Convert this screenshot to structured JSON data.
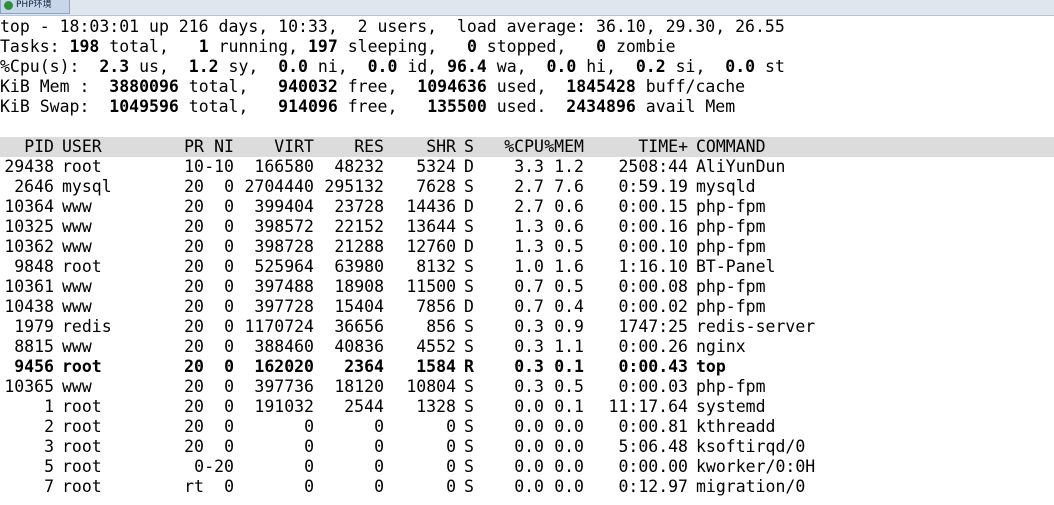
{
  "window": {
    "tab_title": "PHP环境"
  },
  "summary": {
    "line1": "top - 18:03:01 up 216 days, 10:33,  2 users,  load average: 36.10, 29.30, 26.55",
    "tasks": [
      {
        "t": "Tasks: ",
        "b": false
      },
      {
        "t": "198",
        "b": true
      },
      {
        "t": " total,   ",
        "b": false
      },
      {
        "t": "1",
        "b": true
      },
      {
        "t": " running, ",
        "b": false
      },
      {
        "t": "197",
        "b": true
      },
      {
        "t": " sleeping,   ",
        "b": false
      },
      {
        "t": "0",
        "b": true
      },
      {
        "t": " stopped,   ",
        "b": false
      },
      {
        "t": "0",
        "b": true
      },
      {
        "t": " zombie",
        "b": false
      }
    ],
    "cpu": [
      {
        "t": "%Cpu(s):  ",
        "b": false
      },
      {
        "t": "2.3",
        "b": true
      },
      {
        "t": " us,  ",
        "b": false
      },
      {
        "t": "1.2",
        "b": true
      },
      {
        "t": " sy,  ",
        "b": false
      },
      {
        "t": "0.0",
        "b": true
      },
      {
        "t": " ni,  ",
        "b": false
      },
      {
        "t": "0.0",
        "b": true
      },
      {
        "t": " id, ",
        "b": false
      },
      {
        "t": "96.4",
        "b": true
      },
      {
        "t": " wa,  ",
        "b": false
      },
      {
        "t": "0.0",
        "b": true
      },
      {
        "t": " hi,  ",
        "b": false
      },
      {
        "t": "0.2",
        "b": true
      },
      {
        "t": " si,  ",
        "b": false
      },
      {
        "t": "0.0",
        "b": true
      },
      {
        "t": " st",
        "b": false
      }
    ],
    "mem": [
      {
        "t": "KiB Mem :  ",
        "b": false
      },
      {
        "t": "3880096",
        "b": true
      },
      {
        "t": " total,   ",
        "b": false
      },
      {
        "t": "940032",
        "b": true
      },
      {
        "t": " free,  ",
        "b": false
      },
      {
        "t": "1094636",
        "b": true
      },
      {
        "t": " used,  ",
        "b": false
      },
      {
        "t": "1845428",
        "b": true
      },
      {
        "t": " buff/cache",
        "b": false
      }
    ],
    "swap": [
      {
        "t": "KiB Swap:  ",
        "b": false
      },
      {
        "t": "1049596",
        "b": true
      },
      {
        "t": " total,   ",
        "b": false
      },
      {
        "t": "914096",
        "b": true
      },
      {
        "t": " free,   ",
        "b": false
      },
      {
        "t": "135500",
        "b": true
      },
      {
        "t": " used.  ",
        "b": false
      },
      {
        "t": "2434896",
        "b": true
      },
      {
        "t": " avail Mem",
        "b": false
      }
    ]
  },
  "process_table": {
    "columns": [
      "PID",
      "USER",
      "PR",
      "NI",
      "VIRT",
      "RES",
      "SHR",
      "S",
      "%CPU",
      "%MEM",
      "TIME+",
      "COMMAND"
    ],
    "rows": [
      [
        "29438",
        "root",
        "10",
        "-10",
        "166580",
        "48232",
        "5324",
        "D",
        "3.3",
        "1.2",
        "2508:44",
        "AliYunDun"
      ],
      [
        "2646",
        "mysql",
        "20",
        "0",
        "2704440",
        "295132",
        "7628",
        "S",
        "2.7",
        "7.6",
        "0:59.19",
        "mysqld"
      ],
      [
        "10364",
        "www",
        "20",
        "0",
        "399404",
        "23728",
        "14436",
        "D",
        "2.7",
        "0.6",
        "0:00.15",
        "php-fpm"
      ],
      [
        "10325",
        "www",
        "20",
        "0",
        "398572",
        "22152",
        "13644",
        "S",
        "1.3",
        "0.6",
        "0:00.16",
        "php-fpm"
      ],
      [
        "10362",
        "www",
        "20",
        "0",
        "398728",
        "21288",
        "12760",
        "D",
        "1.3",
        "0.5",
        "0:00.10",
        "php-fpm"
      ],
      [
        "9848",
        "root",
        "20",
        "0",
        "525964",
        "63980",
        "8132",
        "S",
        "1.0",
        "1.6",
        "1:16.10",
        "BT-Panel"
      ],
      [
        "10361",
        "www",
        "20",
        "0",
        "397488",
        "18908",
        "11500",
        "S",
        "0.7",
        "0.5",
        "0:00.08",
        "php-fpm"
      ],
      [
        "10438",
        "www",
        "20",
        "0",
        "397728",
        "15404",
        "7856",
        "D",
        "0.7",
        "0.4",
        "0:00.02",
        "php-fpm"
      ],
      [
        "1979",
        "redis",
        "20",
        "0",
        "1170724",
        "36656",
        "856",
        "S",
        "0.3",
        "0.9",
        "1747:25",
        "redis-server"
      ],
      [
        "8815",
        "www",
        "20",
        "0",
        "388460",
        "40836",
        "4552",
        "S",
        "0.3",
        "1.1",
        "0:00.26",
        "nginx"
      ],
      [
        "9456",
        "root",
        "20",
        "0",
        "162020",
        "2364",
        "1584",
        "R",
        "0.3",
        "0.1",
        "0:00.43",
        "top"
      ],
      [
        "10365",
        "www",
        "20",
        "0",
        "397736",
        "18120",
        "10804",
        "S",
        "0.3",
        "0.5",
        "0:00.03",
        "php-fpm"
      ],
      [
        "1",
        "root",
        "20",
        "0",
        "191032",
        "2544",
        "1328",
        "S",
        "0.0",
        "0.1",
        "11:17.64",
        "systemd"
      ],
      [
        "2",
        "root",
        "20",
        "0",
        "0",
        "0",
        "0",
        "S",
        "0.0",
        "0.0",
        "0:00.81",
        "kthreadd"
      ],
      [
        "3",
        "root",
        "20",
        "0",
        "0",
        "0",
        "0",
        "S",
        "0.0",
        "0.0",
        "5:06.48",
        "ksoftirqd/0"
      ],
      [
        "5",
        "root",
        "0",
        "-20",
        "0",
        "0",
        "0",
        "S",
        "0.0",
        "0.0",
        "0:00.00",
        "kworker/0:0H"
      ],
      [
        "7",
        "root",
        "rt",
        "0",
        "0",
        "0",
        "0",
        "S",
        "0.0",
        "0.0",
        "0:12.97",
        "migration/0"
      ]
    ],
    "bold_rows": [
      10
    ]
  },
  "colors": {
    "header_bg": "#dcdcdc",
    "background": "#ffffff",
    "text": "#000000"
  }
}
